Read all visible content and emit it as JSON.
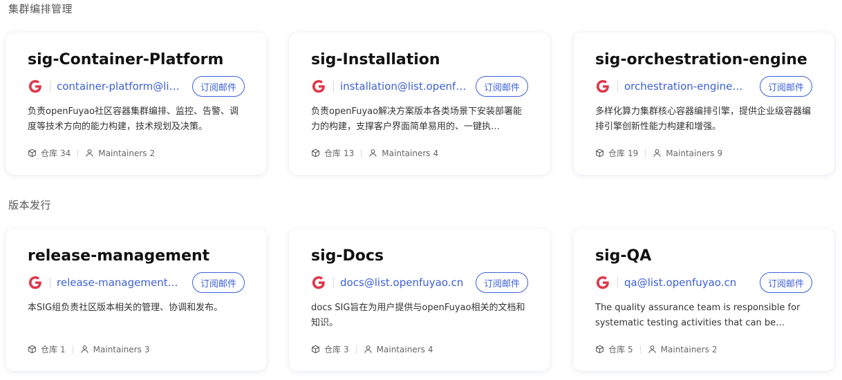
{
  "sections": [
    {
      "title": "集群编排管理",
      "cards": [
        {
          "title": "sig-Container-Platform",
          "email": "container-platform@list.openfuyao.cn",
          "subscribe_label": "订阅邮件",
          "description": "负责openFuyao社区容器集群编排、监控、告警、调度等技术方向的能力构建，技术规划及决策。",
          "repo_label": "仓库",
          "repo_count": "34",
          "maintainers_label": "Maintainers",
          "maintainers_count": "2"
        },
        {
          "title": "sig-Installation",
          "email": "installation@list.openfuyao.cn",
          "subscribe_label": "订阅邮件",
          "description": "负责openFuyao解决方案版本各类场景下安装部署能力的构建，支撑客户界面简单易用的、一键执…",
          "repo_label": "仓库",
          "repo_count": "13",
          "maintainers_label": "Maintainers",
          "maintainers_count": "4"
        },
        {
          "title": "sig-orchestration-engine",
          "email": "orchestration-engine@list.openfuyao.cn",
          "subscribe_label": "订阅邮件",
          "description": "多样化算力集群核心容器编排引擎，提供企业级容器编排引擎创新性能力构建和增强。",
          "repo_label": "仓库",
          "repo_count": "19",
          "maintainers_label": "Maintainers",
          "maintainers_count": "9"
        }
      ]
    },
    {
      "title": "版本发行",
      "cards": [
        {
          "title": "release-management",
          "email": "release-management@list.openfuyao.cn",
          "subscribe_label": "订阅邮件",
          "description": "本SIG组负责社区版本相关的管理、协调和发布。",
          "repo_label": "仓库",
          "repo_count": "1",
          "maintainers_label": "Maintainers",
          "maintainers_count": "3"
        },
        {
          "title": "sig-Docs",
          "email": "docs@list.openfuyao.cn",
          "subscribe_label": "订阅邮件",
          "description": "docs SIG旨在为用户提供与openFuyao相关的文档和知识。",
          "repo_label": "仓库",
          "repo_count": "3",
          "maintainers_label": "Maintainers",
          "maintainers_count": "4"
        },
        {
          "title": "sig-QA",
          "email": "qa@list.openfuyao.cn",
          "subscribe_label": "订阅邮件",
          "description": "The quality assurance team is responsible for systematic testing activities that can be…",
          "repo_label": "仓库",
          "repo_count": "5",
          "maintainers_label": "Maintainers",
          "maintainers_count": "2"
        }
      ]
    }
  ],
  "colors": {
    "accent": "#3b5fd8",
    "google_red": "#e0384a"
  },
  "icons": {
    "mail_service": "google-g-icon",
    "repository": "cube-icon",
    "maintainers": "user-icon"
  }
}
